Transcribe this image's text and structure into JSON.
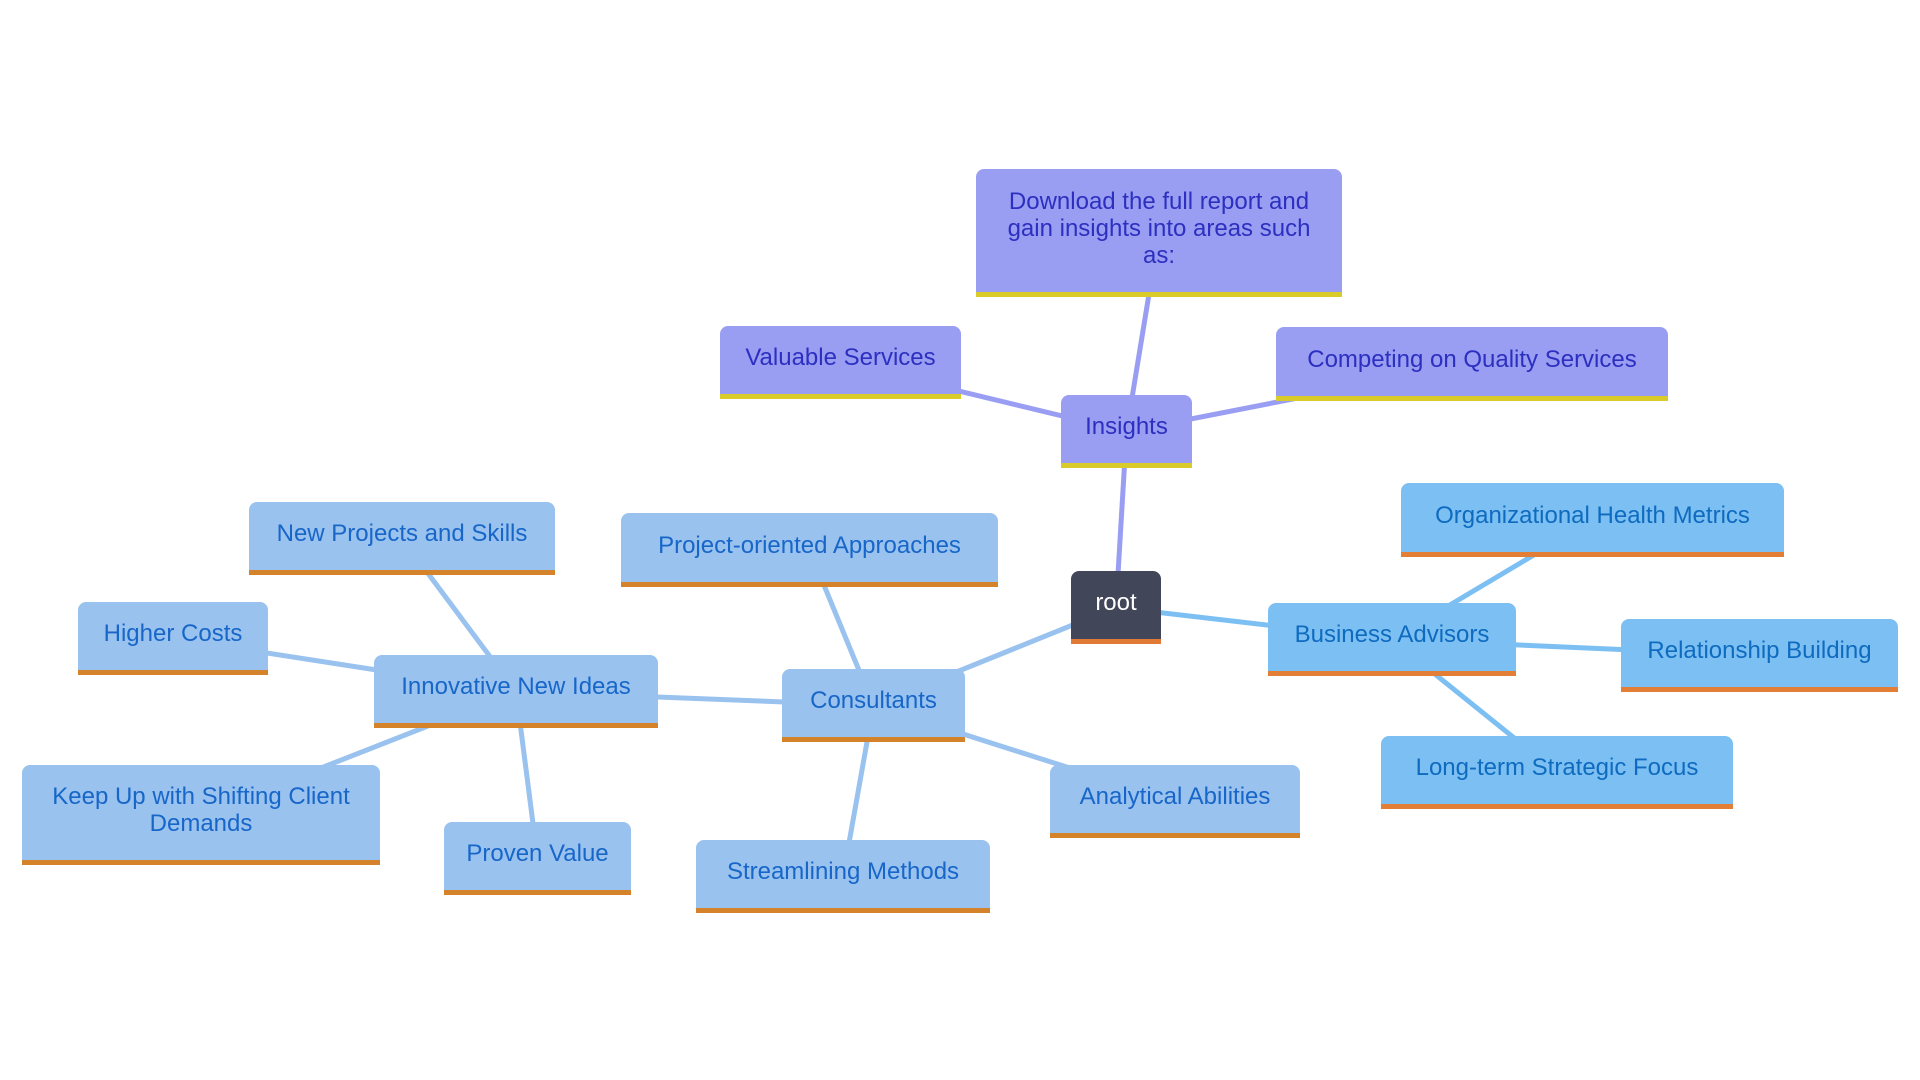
{
  "diagram": {
    "type": "mind-map",
    "colors": {
      "root_fill": "#424659",
      "root_text": "#ffffff",
      "root_underline": "#e07a35",
      "insights_fill": "#999ef3",
      "insights_text": "#2c2fbf",
      "insights_underline": "#d8cb2a",
      "insights_edge": "#999ef3",
      "consultants_fill": "#99c2ef",
      "consultants_text": "#1766c8",
      "consultants_underline": "#d4832a",
      "consultants_edge": "#99c2ef",
      "advisors_fill": "#7cbff2",
      "advisors_text": "#0e6bbf",
      "advisors_underline": "#e27e36",
      "advisors_edge": "#7cbff2"
    },
    "nodes": {
      "root": "root",
      "insights": "Insights",
      "download": "Download the full report and gain insights into areas such as:",
      "valuable_services": "Valuable Services",
      "competing_quality": "Competing on Quality Services",
      "business_advisors": "Business Advisors",
      "org_health": "Organizational Health Metrics",
      "relationship_building": "Relationship Building",
      "long_term_focus": "Long-term Strategic Focus",
      "consultants": "Consultants",
      "project_oriented": "Project-oriented Approaches",
      "analytical_abilities": "Analytical Abilities",
      "streamlining_methods": "Streamlining Methods",
      "innovative_ideas": "Innovative New Ideas",
      "new_projects": "New Projects and Skills",
      "higher_costs": "Higher Costs",
      "keep_up": "Keep Up with Shifting Client Demands",
      "proven_value": "Proven Value"
    },
    "edges": [
      {
        "from": "root",
        "to": "insights",
        "branch": "insights"
      },
      {
        "from": "insights",
        "to": "download",
        "branch": "insights"
      },
      {
        "from": "insights",
        "to": "valuable_services",
        "branch": "insights"
      },
      {
        "from": "insights",
        "to": "competing_quality",
        "branch": "insights"
      },
      {
        "from": "root",
        "to": "business_advisors",
        "branch": "advisors"
      },
      {
        "from": "business_advisors",
        "to": "org_health",
        "branch": "advisors"
      },
      {
        "from": "business_advisors",
        "to": "relationship_building",
        "branch": "advisors"
      },
      {
        "from": "business_advisors",
        "to": "long_term_focus",
        "branch": "advisors"
      },
      {
        "from": "root",
        "to": "consultants",
        "branch": "consultants"
      },
      {
        "from": "consultants",
        "to": "project_oriented",
        "branch": "consultants"
      },
      {
        "from": "consultants",
        "to": "analytical_abilities",
        "branch": "consultants"
      },
      {
        "from": "consultants",
        "to": "streamlining_methods",
        "branch": "consultants"
      },
      {
        "from": "consultants",
        "to": "innovative_ideas",
        "branch": "consultants"
      },
      {
        "from": "innovative_ideas",
        "to": "new_projects",
        "branch": "consultants"
      },
      {
        "from": "innovative_ideas",
        "to": "higher_costs",
        "branch": "consultants"
      },
      {
        "from": "innovative_ideas",
        "to": "keep_up",
        "branch": "consultants"
      },
      {
        "from": "innovative_ideas",
        "to": "proven_value",
        "branch": "consultants"
      }
    ]
  }
}
